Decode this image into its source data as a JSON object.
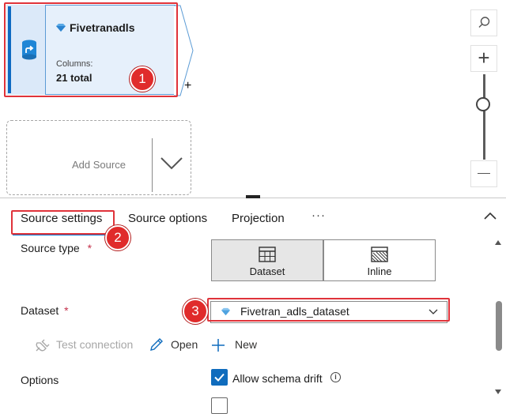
{
  "canvas": {
    "source_node": {
      "title": "Fivetranadls",
      "columns_label": "Columns:",
      "columns_value": "21 total"
    },
    "plus": "+",
    "add_source": {
      "label": "Add Source"
    },
    "zoom": {
      "zoom_in": "+"
    }
  },
  "annotations": {
    "badge1": "1",
    "badge2": "2",
    "badge3": "3"
  },
  "panel": {
    "tabs": [
      {
        "label": "Source settings",
        "active": true
      },
      {
        "label": "Source options",
        "active": false
      },
      {
        "label": "Projection",
        "active": false
      }
    ],
    "more_tabs": "···",
    "source_type": {
      "label": "Source type",
      "required_mark": "*",
      "options": [
        {
          "label": "Dataset",
          "icon": "table-grid-icon",
          "selected": true
        },
        {
          "label": "Inline",
          "icon": "inline-hatched-icon",
          "selected": false
        }
      ]
    },
    "dataset": {
      "label": "Dataset",
      "required_mark": "*",
      "value": "Fivetran_adls_dataset"
    },
    "actions": {
      "test_connection": "Test connection",
      "open": "Open",
      "new": "New"
    },
    "options": {
      "label": "Options",
      "allow_schema_drift": "Allow schema drift",
      "allow_schema_drift_checked": true
    }
  },
  "colors": {
    "accent": "#0078d4",
    "highlight": "#e0333a",
    "node_bg": "#e6f0fb"
  }
}
